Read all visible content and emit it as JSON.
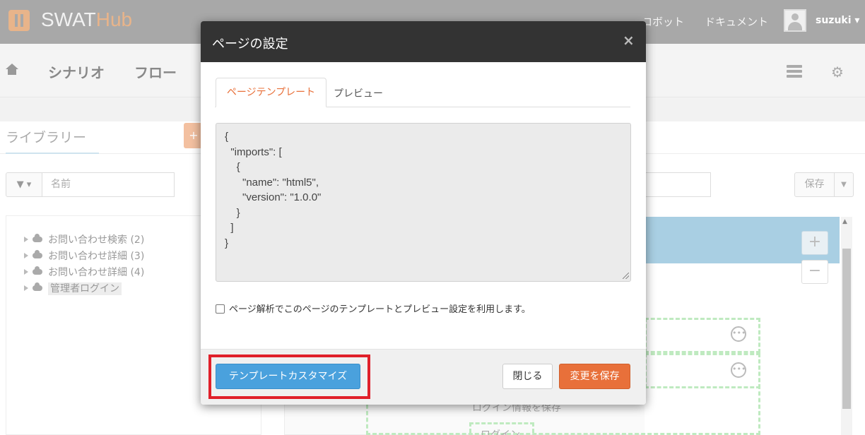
{
  "app": {
    "logo_text_swat": "SWAT",
    "logo_text_hub": "Hub",
    "nav_robot": "ロボット",
    "nav_document": "ドキュメント",
    "user_name": "suzuki ▾"
  },
  "menu": {
    "scenario": "シナリオ",
    "flow": "フロー"
  },
  "library": {
    "title": "ライブラリー",
    "add_label": "+",
    "filter_label": "▼ ▾",
    "search_placeholder": "名前",
    "tree": [
      {
        "label": "お問い合わせ検索 (2)",
        "selected": false
      },
      {
        "label": "お問い合わせ詳細 (3)",
        "selected": false
      },
      {
        "label": "お問い合わせ詳細 (4)",
        "selected": false
      },
      {
        "label": "管理者ログイン",
        "selected": true
      }
    ]
  },
  "editor": {
    "save_label": "保存",
    "zoom_in": "+",
    "zoom_out": "−",
    "step_save_login": "ログイン情報を保存",
    "step_login": "ログイン"
  },
  "modal": {
    "title": "ページの設定",
    "close_glyph": "×",
    "tabs": [
      {
        "label": "ページテンプレート",
        "active": true
      },
      {
        "label": "プレビュー",
        "active": false
      }
    ],
    "template_json": "{\n  \"imports\": [\n    {\n      \"name\": \"html5\",\n      \"version\": \"1.0.0\"\n    }\n  ]\n}",
    "checkbox_label": "ページ解析でこのページのテンプレートとプレビュー設定を利用します。",
    "checkbox_checked": false,
    "buttons": {
      "customize": "テンプレートカスタマイズ",
      "close": "閉じる",
      "save_changes": "変更を保存"
    }
  },
  "colors": {
    "accent_orange": "#e8703a",
    "primary_blue": "#4aa1dd",
    "highlight_red": "#e0202a",
    "modal_header": "#333333"
  }
}
